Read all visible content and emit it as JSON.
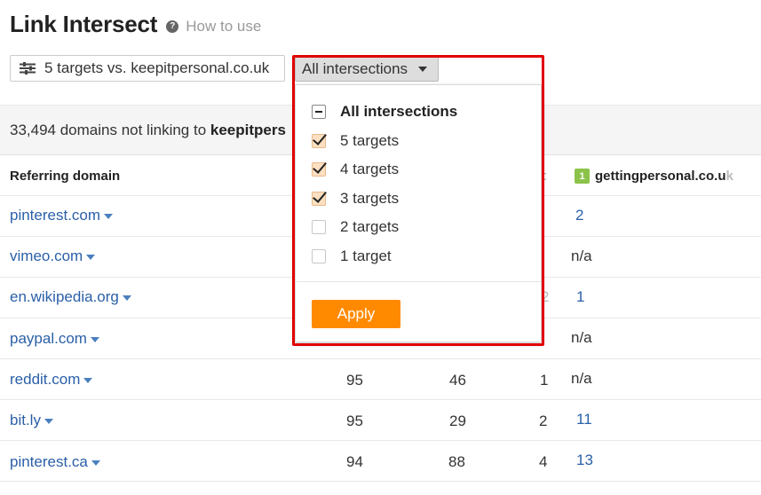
{
  "header": {
    "title": "Link Intersect",
    "help_icon_glyph": "?",
    "how_to_use": "How to use"
  },
  "controls": {
    "targets_label": "5 targets vs. keepitpersonal.co.uk",
    "intersections_label": "All intersections"
  },
  "summary": {
    "prefix": "33,494 domains not linking to ",
    "domain_bold": "keepitpers"
  },
  "table": {
    "col_ref_header": "Referring domain",
    "col4_badge": "1",
    "col4_header_main": "gettingpersonal.co.u",
    "col4_header_fade": "k",
    "rows": [
      {
        "domain": "pinterest.com",
        "c1": "",
        "c2": "",
        "c3": "",
        "c4": "2"
      },
      {
        "domain": "vimeo.com",
        "c1": "",
        "c2": "",
        "c3": "",
        "c4": "n/a"
      },
      {
        "domain": "en.wikipedia.org",
        "c1": "",
        "c2": "",
        "c3": "2",
        "c4": "1"
      },
      {
        "domain": "paypal.com",
        "c1": "",
        "c2": "",
        "c3": "",
        "c4": "n/a"
      },
      {
        "domain": "reddit.com",
        "c1": "95",
        "c2": "46",
        "c3": "1",
        "c4": "n/a"
      },
      {
        "domain": "bit.ly",
        "c1": "95",
        "c2": "29",
        "c3": "2",
        "c4": "11"
      },
      {
        "domain": "pinterest.ca",
        "c1": "94",
        "c2": "88",
        "c3": "4",
        "c4": "13"
      }
    ]
  },
  "dropdown": {
    "options": [
      {
        "label": "All intersections",
        "state": "mixed"
      },
      {
        "label": "5 targets",
        "state": "checked"
      },
      {
        "label": "4 targets",
        "state": "checked"
      },
      {
        "label": "3 targets",
        "state": "checked"
      },
      {
        "label": "2 targets",
        "state": "unchecked"
      },
      {
        "label": "1 target",
        "state": "unchecked"
      }
    ],
    "apply_label": "Apply"
  },
  "colors": {
    "link": "#2a5fa7",
    "apply": "#ff8a00",
    "highlight": "#e00000",
    "badge": "#8bc34a"
  }
}
